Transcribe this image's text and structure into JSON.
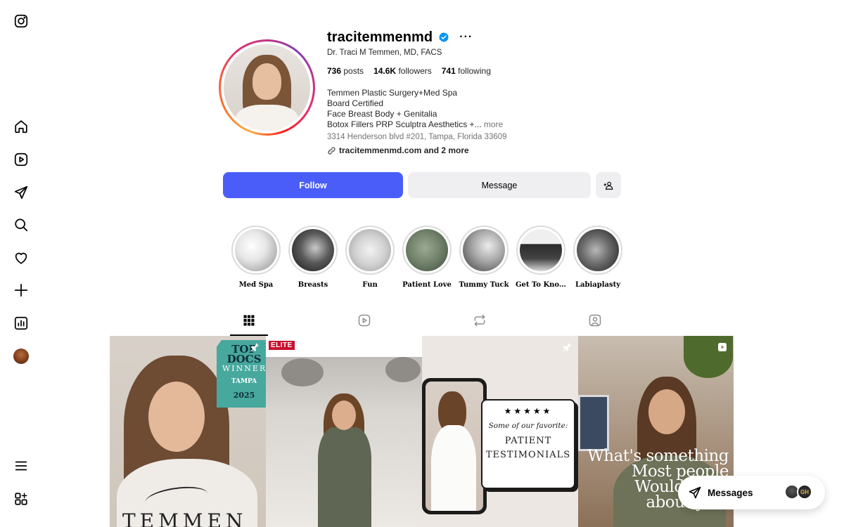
{
  "sidebar": {
    "items": [
      {
        "name": "instagram-logo-icon"
      },
      {
        "name": "home-icon"
      },
      {
        "name": "reels-icon"
      },
      {
        "name": "direct-send-icon"
      },
      {
        "name": "search-icon"
      },
      {
        "name": "heart-icon"
      },
      {
        "name": "plus-icon"
      },
      {
        "name": "insights-icon"
      },
      {
        "name": "profile-avatar"
      },
      {
        "name": "menu-icon"
      },
      {
        "name": "apps-icon"
      }
    ]
  },
  "profile": {
    "username": "tracitemmenmd",
    "verified": true,
    "full_name": "Dr. Traci M Temmen, MD, FACS",
    "stats": {
      "posts_count": "736",
      "posts_label": "posts",
      "followers_count": "14.6K",
      "followers_label": "followers",
      "following_count": "741",
      "following_label": "following"
    },
    "bio_lines": [
      "Temmen Plastic Surgery+Med Spa",
      "Board Certified",
      "Face Breast Body + Genitalia",
      "Botox Fillers PRP Sculptra Aesthetics +..."
    ],
    "bio_more": "more",
    "address": "3314 Henderson blvd #201, Tampa, Florida 33609",
    "link_text": "tracitemmenmd.com and 2 more"
  },
  "actions": {
    "follow_label": "Follow",
    "message_label": "Message",
    "follow_color": "#4a5df9"
  },
  "highlights": [
    {
      "label": "Med Spa"
    },
    {
      "label": "Breasts"
    },
    {
      "label": "Fun"
    },
    {
      "label": "Patient Love"
    },
    {
      "label": "Tummy Tuck"
    },
    {
      "label": "Get To Kno..."
    },
    {
      "label": "Labiaplasty"
    }
  ],
  "tabs": [
    {
      "name": "posts-grid-icon",
      "active": true
    },
    {
      "name": "reels-tab-icon",
      "active": false
    },
    {
      "name": "reposts-icon",
      "active": false
    },
    {
      "name": "tagged-icon",
      "active": false
    }
  ],
  "posts": {
    "p1": {
      "badge_top": "TOP DOCS",
      "badge_winner": "WINNER",
      "badge_city": "TAMPA",
      "badge_year": "2025",
      "brand": "TEMMEN"
    },
    "p2": {
      "elite": "ELITE"
    },
    "p3": {
      "stars": "★★★★★",
      "favorite": "Some of our favorite:",
      "line1": "PATIENT",
      "line2": "TESTIMONIALS"
    },
    "p4": {
      "caption_line1": "What's something",
      "caption_line2": "Most people",
      "caption_line3": "Wouldn't kn",
      "caption_line4": "about you."
    }
  },
  "messages": {
    "label": "Messages",
    "avatar2_initials": "GH"
  }
}
